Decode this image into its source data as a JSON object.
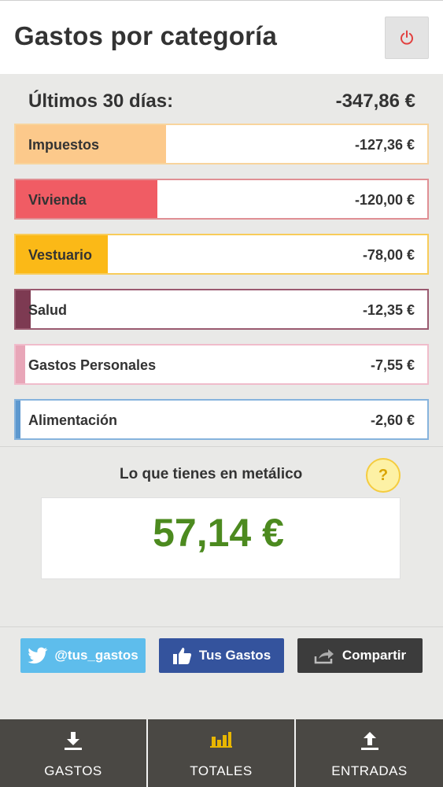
{
  "header": {
    "title": "Gastos por categoría"
  },
  "summary": {
    "label": "Últimos 30 días:",
    "total": "-347,86 €"
  },
  "categories": [
    {
      "name": "Impuestos",
      "amount": "-127,36 €",
      "color": "#fcc98b",
      "border": "#f8d49c",
      "share": 0.366
    },
    {
      "name": "Vivienda",
      "amount": "-120,00 €",
      "color": "#f05c64",
      "border": "#e08f94",
      "share": 0.345
    },
    {
      "name": "Vestuario",
      "amount": "-78,00 €",
      "color": "#fbb917",
      "border": "#f8cc5a",
      "share": 0.224
    },
    {
      "name": "Salud",
      "amount": "-12,35 €",
      "color": "#7d3a52",
      "border": "#9a5a70",
      "share": 0.036
    },
    {
      "name": "Gastos Personales",
      "amount": "-7,55 €",
      "color": "#e8a6b8",
      "border": "#f0bccb",
      "share": 0.022
    },
    {
      "name": "Alimentación",
      "amount": "-2,60 €",
      "color": "#5d98cf",
      "border": "#86b3dd",
      "share": 0.007
    }
  ],
  "cash": {
    "label": "Lo que tienes en metálico",
    "value": "57,14 €",
    "help": "?"
  },
  "social": {
    "twitter": "@tus_gastos",
    "facebook": "Tus Gastos",
    "share": "Compartir"
  },
  "tabs": [
    {
      "label": "GASTOS",
      "icon": "download-icon"
    },
    {
      "label": "TOTALES",
      "icon": "bar-chart-icon"
    },
    {
      "label": "ENTRADAS",
      "icon": "upload-icon"
    }
  ]
}
